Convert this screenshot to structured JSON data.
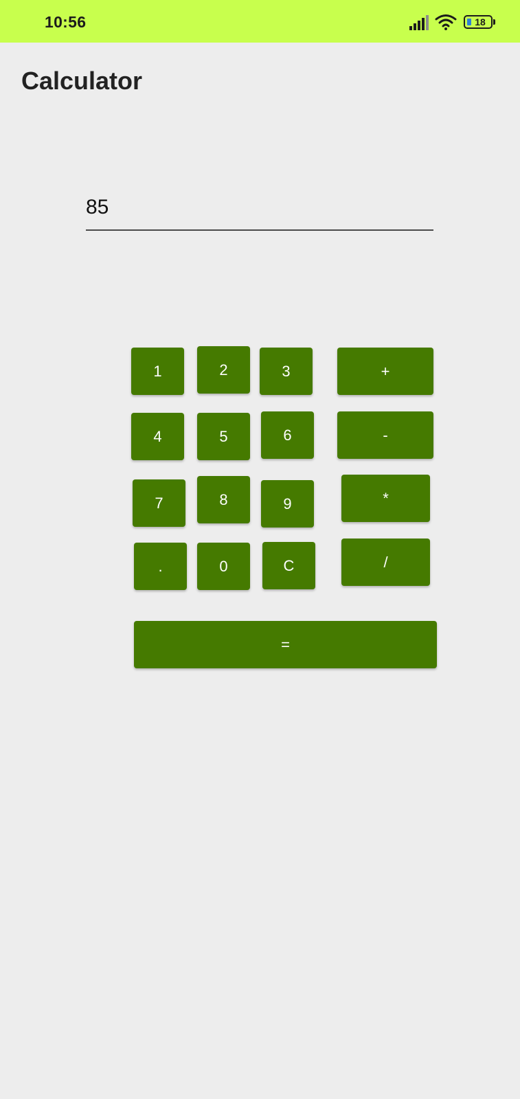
{
  "status_bar": {
    "time": "10:56",
    "battery_level": "18",
    "background": "#c8ff4d",
    "icons": [
      "signal-icon",
      "wifi-icon",
      "battery-icon"
    ]
  },
  "app": {
    "title": "Calculator"
  },
  "display": {
    "value": "85"
  },
  "buttons": {
    "one": "1",
    "two": "2",
    "three": "3",
    "plus": "+",
    "four": "4",
    "five": "5",
    "six": "6",
    "minus": "-",
    "seven": "7",
    "eight": "8",
    "nine": "9",
    "multiply": "*",
    "dot": ".",
    "zero": "0",
    "clear": "C",
    "divide": "/",
    "equals": "="
  },
  "colors": {
    "button": "#457a00",
    "button_text": "#ffffff",
    "background": "#ededed"
  }
}
